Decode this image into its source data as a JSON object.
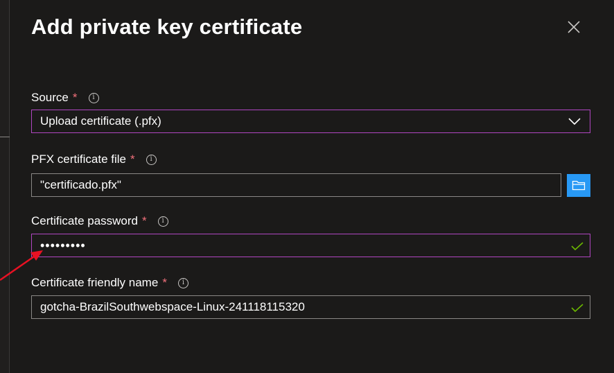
{
  "dialog": {
    "title": "Add private key certificate"
  },
  "fields": {
    "source": {
      "label": "Source",
      "required_marker": "*",
      "value": "Upload certificate (.pfx)"
    },
    "pfx_file": {
      "label": "PFX certificate file",
      "required_marker": "*",
      "value": "\"certificado.pfx\""
    },
    "password": {
      "label": "Certificate password",
      "required_marker": "*",
      "value": "•••••••••"
    },
    "friendly_name": {
      "label": "Certificate friendly name",
      "required_marker": "*",
      "value": "gotcha-BrazilSouthwebspace-Linux-241118115320"
    }
  },
  "icons": {
    "close": "close-icon",
    "info": "info-icon",
    "chevron": "chevron-down-icon",
    "folder": "folder-icon",
    "check": "checkmark-icon"
  },
  "colors": {
    "background": "#1b1a19",
    "required": "#f1707b",
    "focus_border": "#b146c2",
    "accent": "#2899f5",
    "valid_check": "#6bb700",
    "annotation_arrow": "#e81123"
  }
}
